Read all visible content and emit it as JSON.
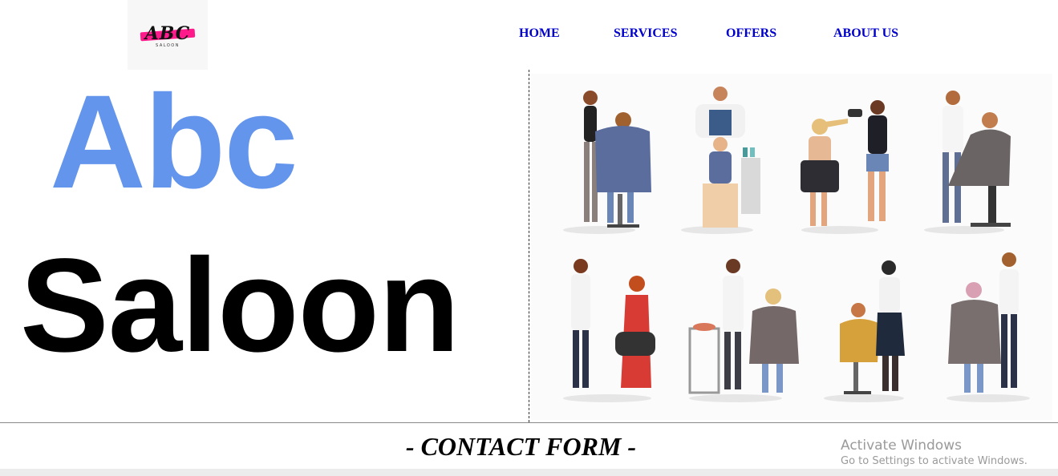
{
  "logo": {
    "mark_text": "ABC",
    "sub_text": "SALOON",
    "accent_color": "#ff1a8c"
  },
  "nav": {
    "items": [
      "HOME",
      "SERVICES",
      "OFFERS",
      "ABOUT US"
    ],
    "link_color": "#0000cc"
  },
  "hero": {
    "title_line1": "Abc",
    "title_line2": "Saloon",
    "title_line1_color": "#6495ed",
    "title_line2_color": "#000000",
    "illustration": "hairdresser-scenes-illustration"
  },
  "contact": {
    "heading": "- CONTACT FORM -"
  },
  "windows_watermark": {
    "line1": "Activate Windows",
    "line2": "Go to Settings to activate Windows."
  }
}
